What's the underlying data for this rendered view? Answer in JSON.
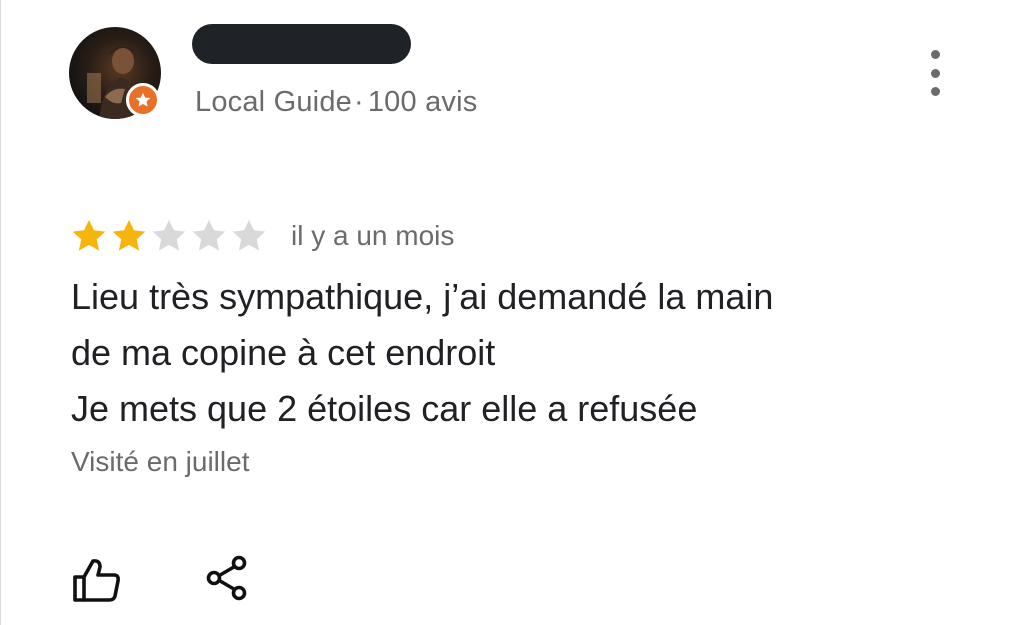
{
  "reviewer": {
    "guide_label": "Local Guide",
    "separator": "·",
    "review_count": "100 avis"
  },
  "rating": {
    "value": 2,
    "max": 5,
    "filled_color": "#f5b50c",
    "empty_color": "#d9d9d9",
    "time_ago": "il y a un mois"
  },
  "review": {
    "lines": [
      "Lieu très sympathique, j’ai demandé la main",
      "de ma copine à cet endroit",
      "Je mets que 2 étoiles car elle a refusée"
    ],
    "visited": "Visité en juillet"
  },
  "icons": {
    "more": "more-vert-icon",
    "like": "thumbs-up-icon",
    "share": "share-icon",
    "badge": "local-guide-star-icon"
  },
  "colors": {
    "badge": "#e8712a",
    "secondary_text": "#6b6b6b",
    "primary_text": "#202124"
  }
}
